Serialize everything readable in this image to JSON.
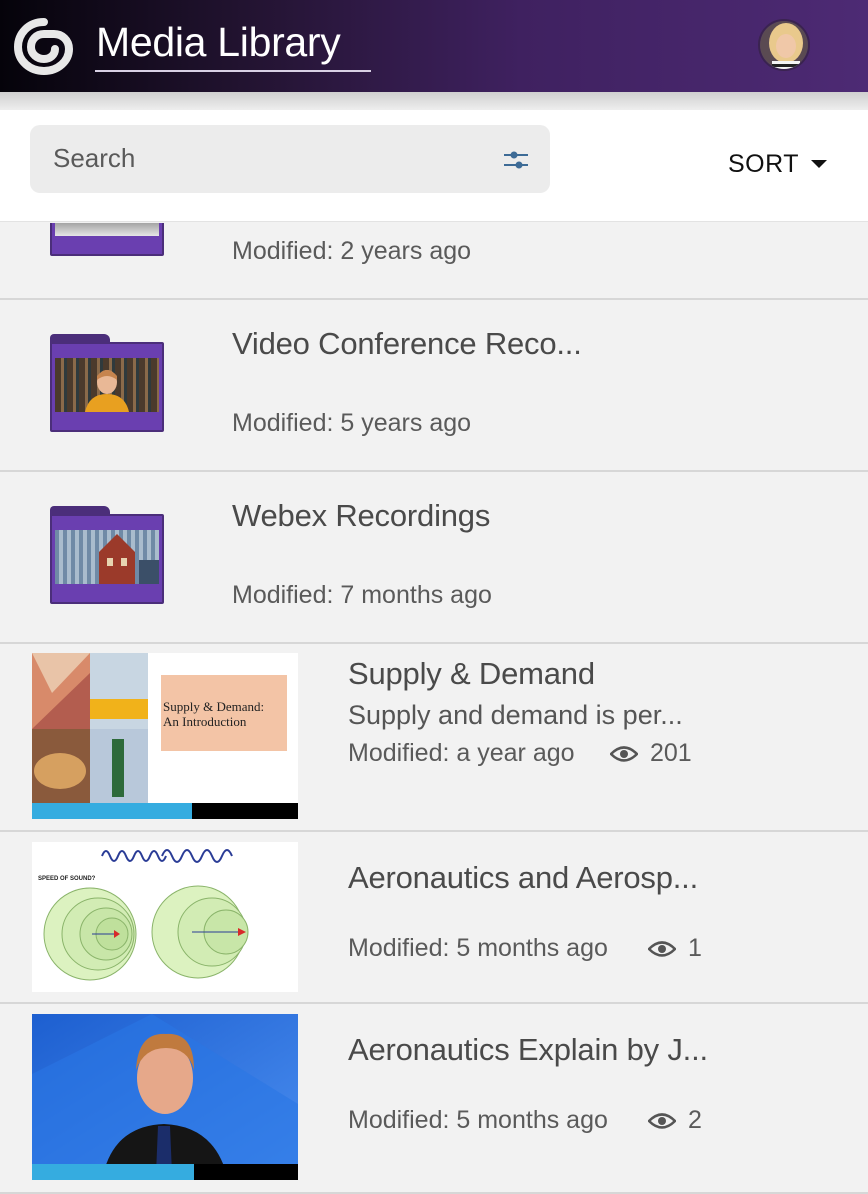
{
  "header": {
    "app_title": "Media Library",
    "logo_icon": "spiral-logo-icon",
    "avatar_icon": "user-avatar"
  },
  "search": {
    "placeholder": "Search",
    "filter_icon": "filter-sliders-icon",
    "sort_label": "SORT"
  },
  "items": [
    {
      "type": "folder",
      "title": "",
      "meta": "Modified: 2 years ago"
    },
    {
      "type": "folder",
      "title": "Video Conference Reco...",
      "meta": "Modified: 5 years ago"
    },
    {
      "type": "folder",
      "title": "Webex Recordings",
      "meta": "Modified: 7 months ago"
    },
    {
      "type": "video",
      "title": "Supply & Demand",
      "description": "Supply and demand is per...",
      "meta": "Modified: a year ago",
      "views": "201",
      "progress": 0.6,
      "thumb_text_line1": "Supply & Demand:",
      "thumb_text_line2": "An Introduction"
    },
    {
      "type": "video",
      "title": "Aeronautics and Aerosp...",
      "description": "",
      "meta": "Modified: 5 months ago",
      "views": "1",
      "progress": 0,
      "thumb_text": "SPEED OF SOUND?"
    },
    {
      "type": "video",
      "title": "Aeronautics Explain by J...",
      "description": "",
      "meta": "Modified: 5 months ago",
      "views": "2",
      "progress": 0.61
    }
  ],
  "colors": {
    "header_start": "#05030a",
    "header_end": "#4d2a74",
    "folder": "#6a3fb0",
    "progress": "#35ace0"
  }
}
